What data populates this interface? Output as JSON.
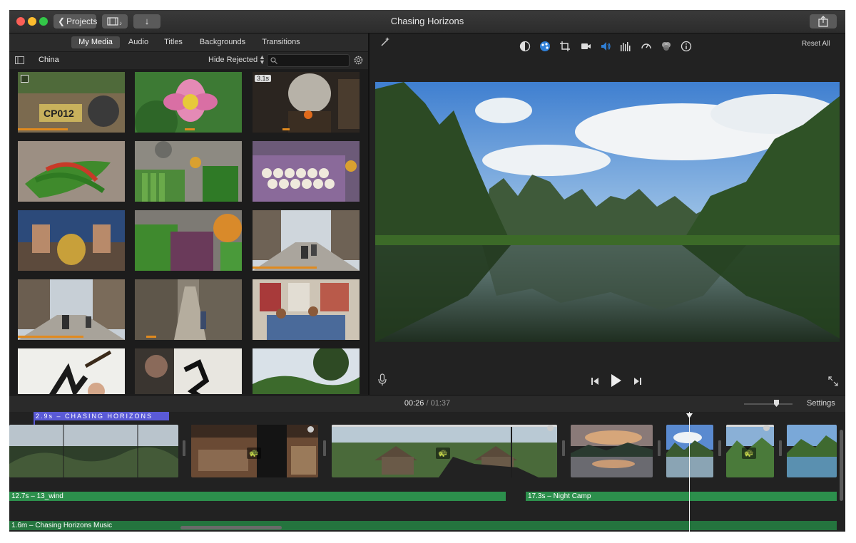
{
  "window": {
    "title": "Chasing Horizons",
    "back_button_label": "Projects"
  },
  "media_tabs": [
    "My Media",
    "Audio",
    "Titles",
    "Backgrounds",
    "Transitions"
  ],
  "browser": {
    "album_name": "China",
    "filter_label": "Hide Rejected",
    "search_value": "",
    "clip_badge": "3.1s"
  },
  "viewer": {
    "reset_label": "Reset All"
  },
  "timeline": {
    "current_time": "00:26",
    "separator": "/",
    "total_time": "01:37",
    "settings_label": "Settings",
    "title_clip": "2.9s – CHASING HORIZONS",
    "audio_1": "12.7s – 13_wind",
    "audio_2": "17.3s – Night Camp",
    "music": "1.6m – Chasing Horizons Music"
  },
  "colors": {
    "accent_blue": "#2f7fd6",
    "title_clip": "#5a5ad6",
    "audio_green": "#2c8f4c",
    "music_green": "#24743e",
    "progress_orange": "#e08a1f"
  }
}
